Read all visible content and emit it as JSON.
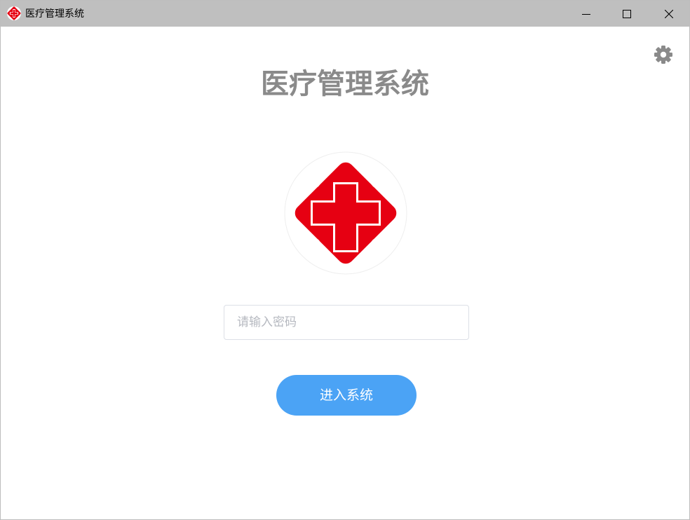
{
  "window": {
    "title": "医疗管理系统"
  },
  "icons": {
    "app": "red-cross-icon",
    "minimize": "minimize-icon",
    "maximize": "maximize-icon",
    "close": "close-icon",
    "settings": "gear-icon",
    "logo": "red-cross-logo"
  },
  "main": {
    "heading": "医疗管理系统",
    "password_placeholder": "请输入密码",
    "password_value": "",
    "enter_label": "进入系统"
  },
  "colors": {
    "titlebar": "#bfbfbf",
    "heading": "#8a8a8a",
    "cross_red": "#e60012",
    "button_blue": "#4ba3f5",
    "gear": "#8a8a8a"
  }
}
